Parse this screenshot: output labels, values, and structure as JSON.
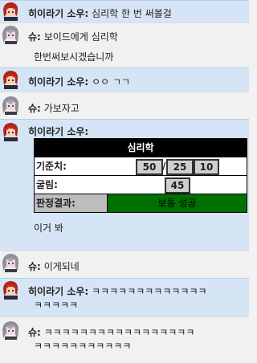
{
  "messages": [
    {
      "speaker": "히이라기 소우",
      "text": "심리학 한 번 써볼걸"
    },
    {
      "speaker": "슈",
      "text": "보이드에게 심리학",
      "text2": "한번써보시겠습니까"
    },
    {
      "speaker": "히이라기 소우",
      "text": "ㅇㅇ ㄱㄱ"
    },
    {
      "speaker": "슈",
      "text": "가보자고"
    },
    {
      "speaker": "히이라기 소우",
      "text": ""
    },
    {
      "speaker": "슈",
      "text": "이게되네"
    },
    {
      "speaker": "히이라기 소우",
      "text": "ㅋㅋㅋㅋㅋㅋㅋㅋㅋㅋㅋㅋㅋ",
      "text2": "ㅋㅋㅋㅋㅋ"
    },
    {
      "speaker": "슈",
      "text": "ㅋㅋㅋㅋㅋㅋㅋㅋㅋㅋㅋㅋㅋㅋㅋㅋㅋ",
      "text2": "ㅋㅋㅋㅋㅋㅋㅋㅋㅋㅋㅋ"
    }
  ],
  "colon": ":",
  "roll": {
    "title": "심리학",
    "threshold_label": "기준치:",
    "thresholds": [
      "50",
      "25",
      "10"
    ],
    "slash": "/",
    "roll_label": "굴림:",
    "roll_value": "45",
    "result_label": "판정결과:",
    "result_value": "보통 성공",
    "result_color": "#007000"
  },
  "after_roll_text": "이거 봐",
  "colors": {
    "blue_row": "#d6e5f5",
    "gray_row": "#f1f1f1"
  },
  "icons": {
    "hiiragi": "red-haired-avatar-icon",
    "shu": "silver-haired-avatar-icon"
  }
}
